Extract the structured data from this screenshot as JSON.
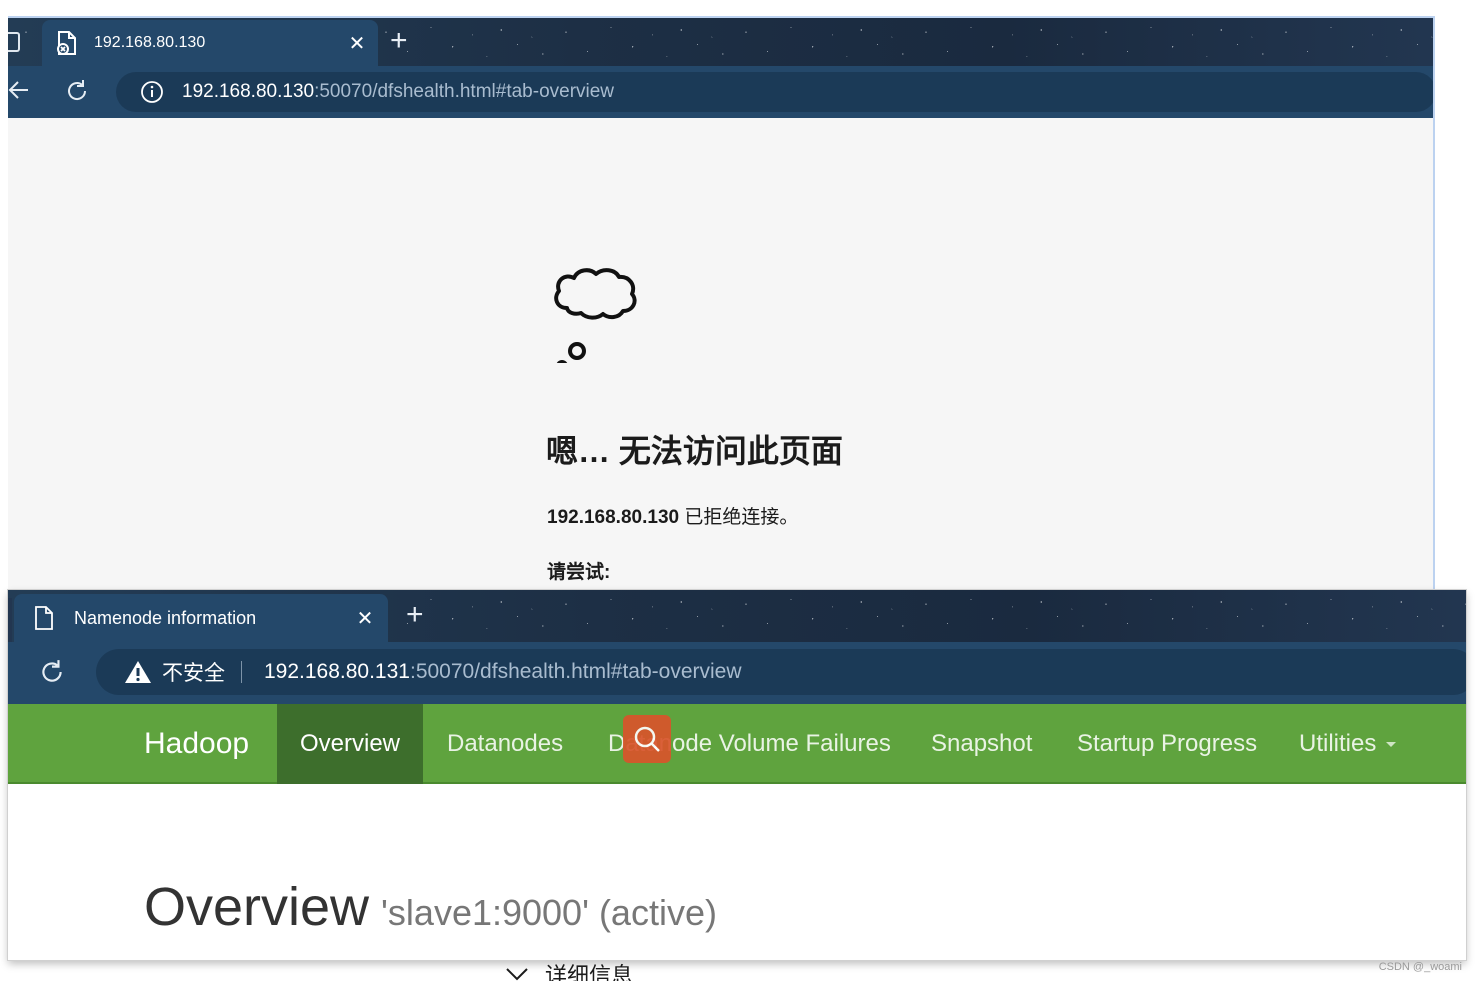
{
  "window1": {
    "tab_title": "192.168.80.130",
    "address_host": "192.168.80.130",
    "address_path": ":50070/dfshealth.html#tab-overview",
    "error_title": "嗯… 无法访问此页面",
    "error_host": "192.168.80.130",
    "error_message": " 已拒绝连接。",
    "try_label": "请尝试:"
  },
  "window2": {
    "tab_title": "Namenode information",
    "security_label": "不安全",
    "address_host": "192.168.80.131",
    "address_path": ":50070/dfshealth.html#tab-overview",
    "nav": {
      "brand": "Hadoop",
      "items": [
        "Overview",
        "Datanodes",
        "Datanode Volume Failures",
        "Snapshot",
        "Startup Progress",
        "Utilities"
      ]
    },
    "overview_title": "Overview",
    "overview_subtitle": "'slave1:9000' (active)"
  },
  "details_label": "详细信息",
  "watermark": "CSDN @_woami",
  "colors": {
    "hadoop_green": "#5fa33e",
    "active_tab_green": "#3d6e2c",
    "browser_blue": "#24486a"
  }
}
